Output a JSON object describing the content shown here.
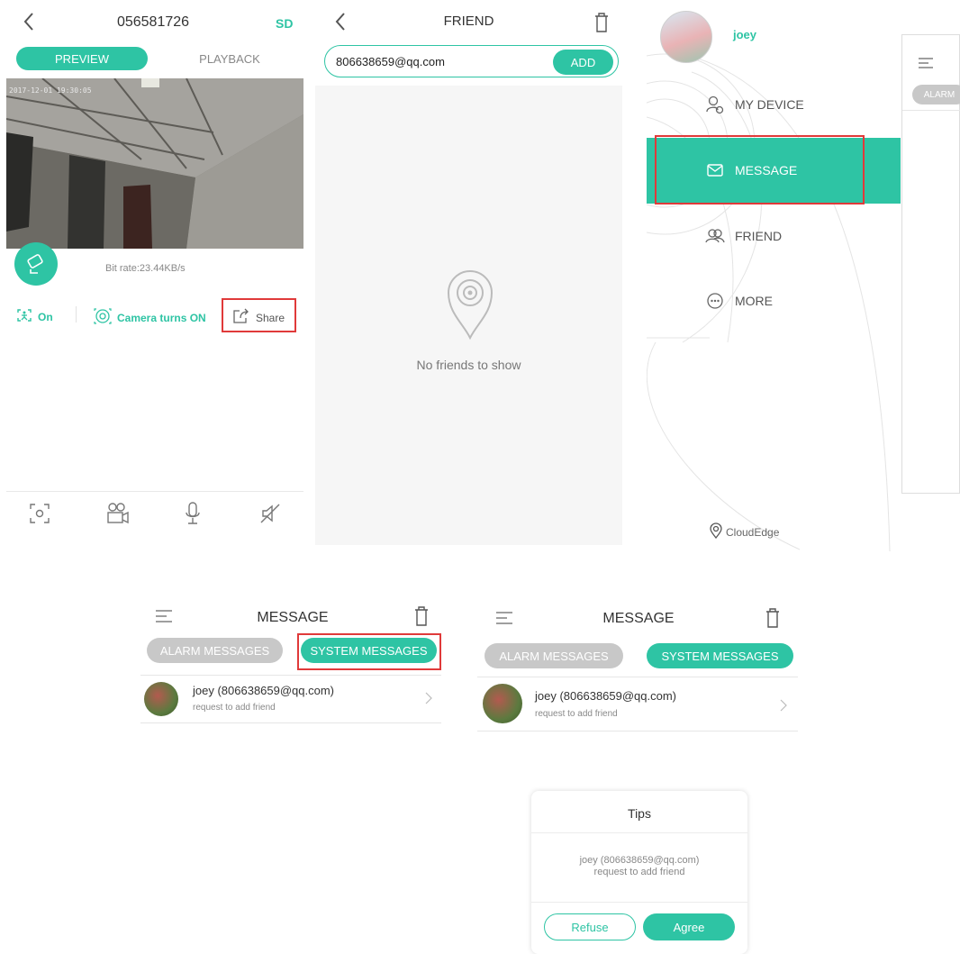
{
  "panel1": {
    "title": "056581726",
    "sd_label": "SD",
    "tab_preview": "PREVIEW",
    "tab_playback": "PLAYBACK",
    "timestamp": "2017-12-01 19:30:05",
    "bitrate": "Bit rate:23.44KB/s",
    "motion_label": "On",
    "camera_label": "Camera turns ON",
    "share_label": "Share",
    "icons": [
      "back-icon",
      "camera-icon",
      "motion-icon",
      "camera-on-icon",
      "share-icon",
      "screenshot-icon",
      "record-icon",
      "mic-icon",
      "mute-icon"
    ]
  },
  "panel2": {
    "title": "FRIEND",
    "email_value": "806638659@qq.com",
    "add_label": "ADD",
    "empty_text": "No friends to show"
  },
  "panel3": {
    "username": "joey",
    "menu": [
      {
        "label": "MY DEVICE",
        "icon": "device-icon"
      },
      {
        "label": "MESSAGE",
        "icon": "message-icon"
      },
      {
        "label": "FRIEND",
        "icon": "friend-icon"
      },
      {
        "label": "MORE",
        "icon": "more-icon"
      }
    ],
    "brand": "CloudEdge"
  },
  "panel4": {
    "alarm_tab": "ALARM"
  },
  "messages": {
    "title": "MESSAGE",
    "tab_alarm": "ALARM MESSAGES",
    "tab_system": "SYSTEM MESSAGES",
    "item_name": "joey (806638659@qq.com)",
    "item_sub": "request to add friend"
  },
  "dialog": {
    "title": "Tips",
    "text_line1": "joey (806638659@qq.com)",
    "text_line2": "request to add friend",
    "refuse": "Refuse",
    "agree": "Agree"
  },
  "colors": {
    "accent": "#2ec4a4",
    "highlight": "#e03a3a",
    "inactive_tab": "#c8c8c8"
  }
}
